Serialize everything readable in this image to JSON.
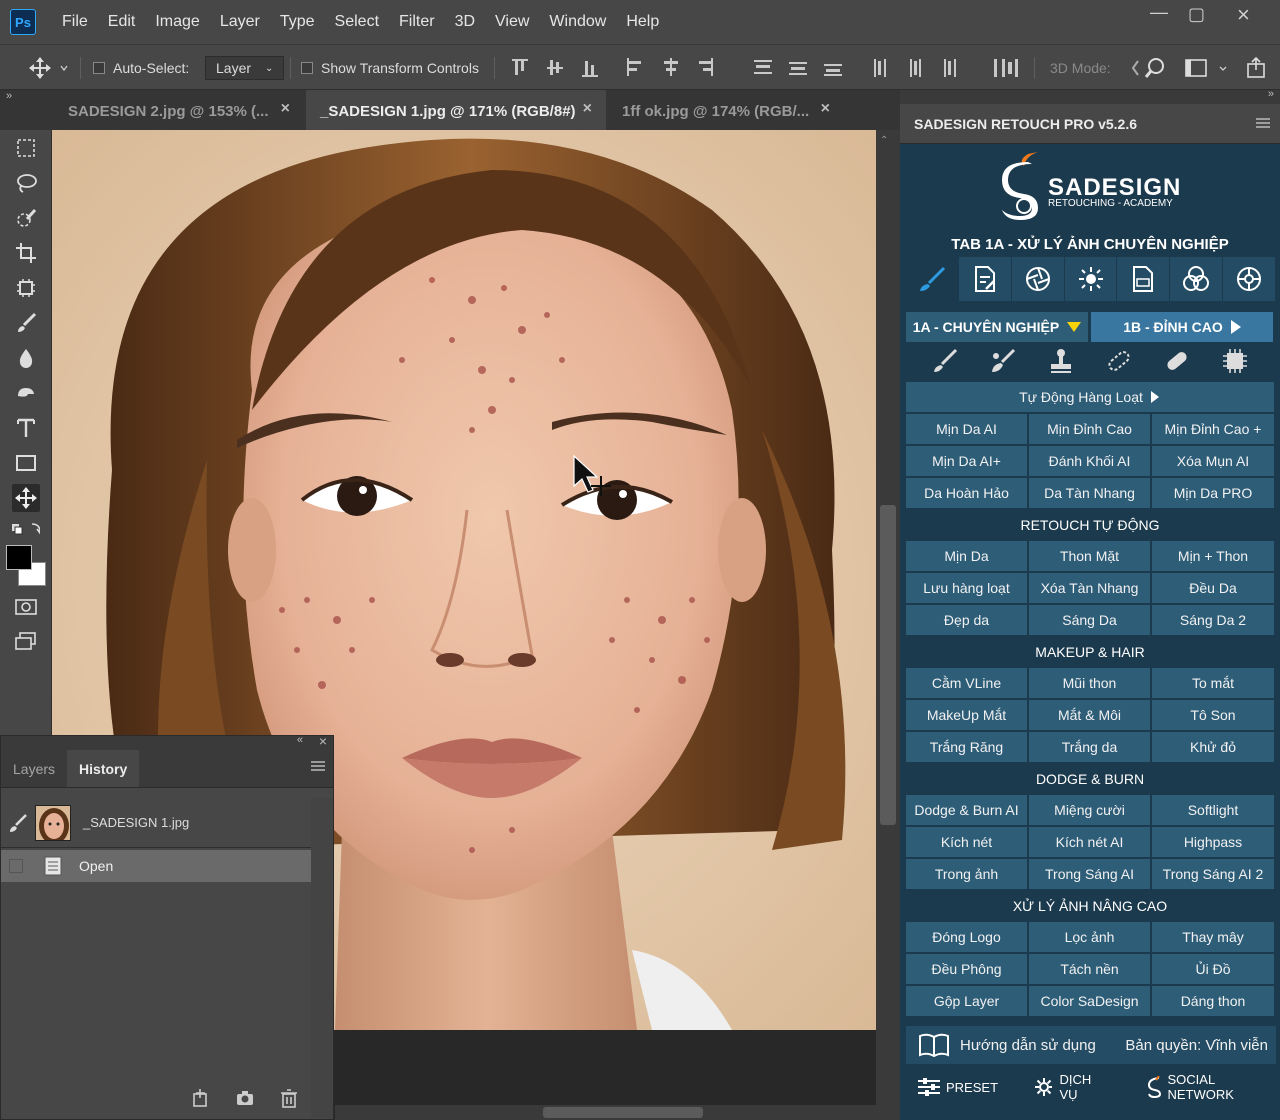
{
  "app": {
    "logo": "Ps"
  },
  "menu": [
    "File",
    "Edit",
    "Image",
    "Layer",
    "Type",
    "Select",
    "Filter",
    "3D",
    "View",
    "Window",
    "Help"
  ],
  "options": {
    "auto_select_label": "Auto-Select:",
    "auto_select_value": "Layer",
    "show_transform": "Show Transform Controls",
    "mode_3d": "3D Mode:"
  },
  "tabs": [
    {
      "label": "SADESIGN 2.jpg @ 153% (...",
      "close": "×"
    },
    {
      "label": "_SADESIGN 1.jpg @ 171% (RGB/8#)",
      "close": "×"
    },
    {
      "label": "1ff ok.jpg @ 174% (RGB/...",
      "close": "×"
    }
  ],
  "history_panel": {
    "tabs": [
      "Layers",
      "History"
    ],
    "items": [
      {
        "label": "_SADESIGN 1.jpg"
      },
      {
        "label": "Open"
      }
    ]
  },
  "plugin": {
    "panel_title": "SADESIGN RETOUCH PRO v5.2.6",
    "brand": "SADESIGN",
    "brand_sub": "RETOUCHING - ACADEMY",
    "tab_title": "TAB 1A - XỬ LÝ ẢNH CHUYÊN NGHIỆP",
    "subtab_1a": "1A - CHUYÊN NGHIỆP",
    "subtab_1b": "1B - ĐỈNH CAO",
    "auto_batch": "Tự Động Hàng Loạt",
    "row1": [
      "Mịn Da AI",
      "Mịn Đỉnh Cao",
      "Mịn Đỉnh Cao +"
    ],
    "row2": [
      "Mịn Da AI+",
      "Đánh Khối AI",
      "Xóa Mụn AI"
    ],
    "row3": [
      "Da Hoàn Hảo",
      "Da Tàn Nhang",
      "Mịn Da PRO"
    ],
    "sec_retouch": "RETOUCH TỰ ĐỘNG",
    "row4": [
      "Mịn Da",
      "Thon Mặt",
      "Mịn + Thon"
    ],
    "row5": [
      "Lưu hàng loạt",
      "Xóa Tàn Nhang",
      "Đều Da"
    ],
    "row6": [
      "Đẹp da",
      "Sáng Da",
      "Sáng Da 2"
    ],
    "sec_makeup": "MAKEUP & HAIR",
    "row7": [
      "Cằm VLine",
      "Mũi thon",
      "To mắt"
    ],
    "row8": [
      "MakeUp Mắt",
      "Mắt & Môi",
      "Tô Son"
    ],
    "row9": [
      "Trắng Răng",
      "Trắng da",
      "Khử đỏ"
    ],
    "sec_dodge": "DODGE & BURN",
    "row10": [
      "Dodge & Burn AI",
      "Miệng cười",
      "Softlight"
    ],
    "row11": [
      "Kích nét",
      "Kích nét AI",
      "Highpass"
    ],
    "row12": [
      "Trong ảnh",
      "Trong Sáng AI",
      "Trong Sáng AI 2"
    ],
    "sec_advanced": "XỬ LÝ ẢNH NÂNG CAO",
    "row13": [
      "Đóng Logo",
      "Lọc ảnh",
      "Thay mây"
    ],
    "row14": [
      "Đều Phông",
      "Tách nền",
      "Ủi Đồ"
    ],
    "row15": [
      "Gộp Layer",
      "Color SaDesign",
      "Dáng thon"
    ],
    "guide": "Hướng dẫn sử dụng",
    "license": "Bản quyền: Vĩnh viễn",
    "preset": "PRESET",
    "service": "DỊCH VỤ",
    "social": "SOCIAL NETWORK"
  }
}
